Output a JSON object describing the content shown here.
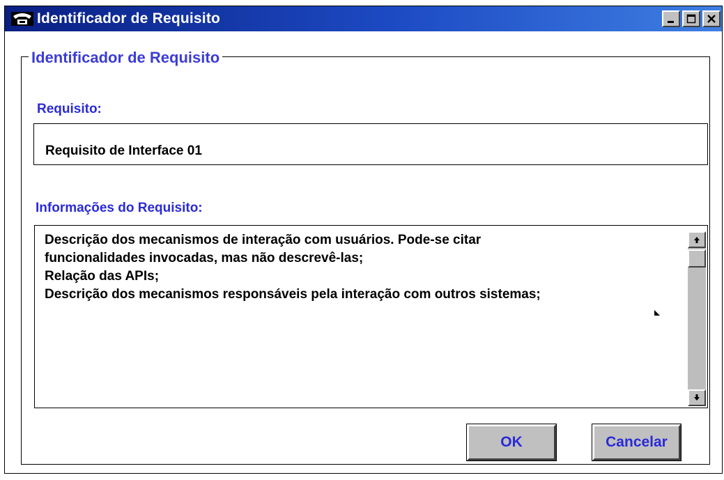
{
  "window": {
    "title": "Identificador de Requisito",
    "titlebar_gradient": [
      "#0a1f82",
      "#3f7fe2"
    ],
    "controls": {
      "minimize": "minimize-icon",
      "maximize": "maximize-icon",
      "close": "close-icon"
    }
  },
  "group": {
    "title": "Identificador de Requisito",
    "title_color": "#3c3cd6"
  },
  "requisito": {
    "label": "Requisito:",
    "value": "Requisito de Interface 01"
  },
  "informacoes": {
    "label": "Informações do Requisito:",
    "lines": [
      "Descrição dos mecanismos de interação com usuários. Pode-se citar",
      "funcionalidades invocadas, mas não descrevê-las;",
      "Relação das APIs;",
      "Descrição dos mecanismos responsáveis pela interação com outros sistemas;"
    ]
  },
  "buttons": {
    "ok": "OK",
    "cancel": "Cancelar"
  },
  "colors": {
    "label_blue": "#2a2ad8",
    "button_face": "#c0c0c0"
  }
}
